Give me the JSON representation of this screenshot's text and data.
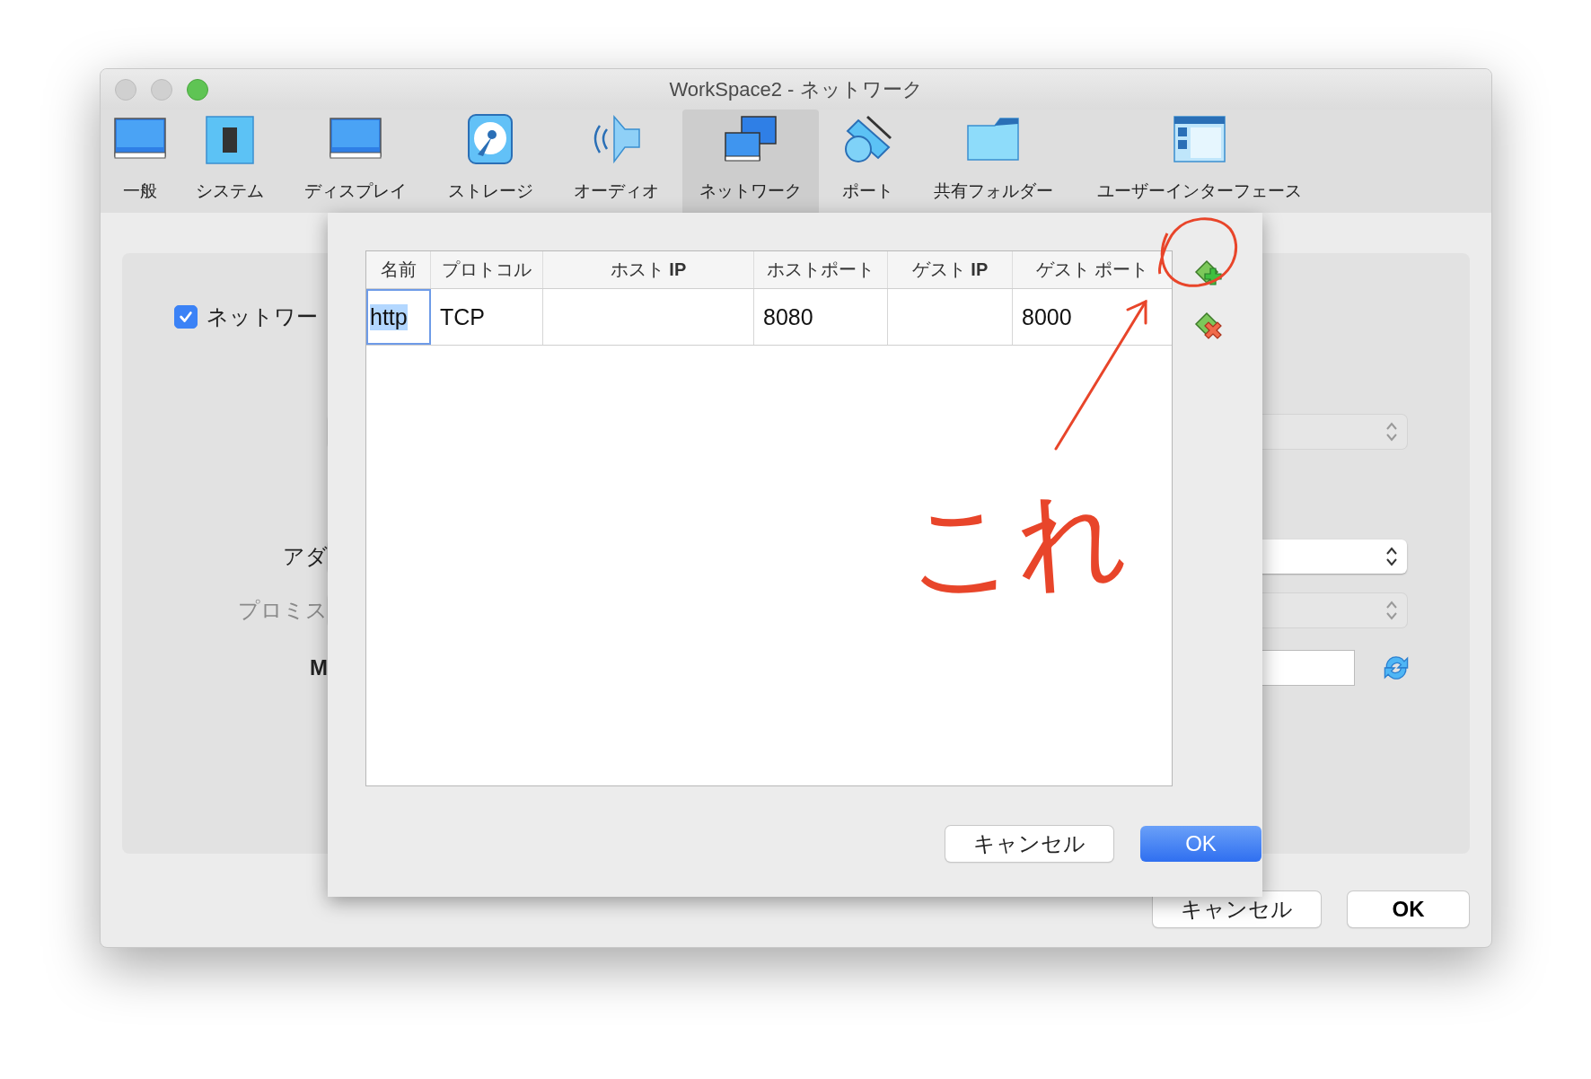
{
  "window": {
    "title": "WorkSpace2 - ネットワーク"
  },
  "tabs": [
    {
      "label": "一般",
      "selected": false
    },
    {
      "label": "システム",
      "selected": false
    },
    {
      "label": "ディスプレイ",
      "selected": false
    },
    {
      "label": "ストレージ",
      "selected": false
    },
    {
      "label": "オーディオ",
      "selected": false
    },
    {
      "label": "ネットワーク",
      "selected": true
    },
    {
      "label": "ポート",
      "selected": false
    },
    {
      "label": "共有フォルダー",
      "selected": false
    },
    {
      "label": "ユーザーインターフェース",
      "selected": false
    }
  ],
  "settings": {
    "enable": {
      "label": "ネットワー",
      "checked": true
    },
    "rows": [
      {
        "kind": "select",
        "disabled": true
      },
      {
        "kind": "select",
        "label": "アダ",
        "disabled": false
      },
      {
        "kind": "select",
        "label": "プロミス",
        "disabled": true
      },
      {
        "kind": "text",
        "label": "M",
        "disabled": false
      }
    ]
  },
  "dialog": {
    "columns": [
      "名前",
      "プロトコル",
      "ホスト **IP**",
      "ホストポート",
      "ゲスト **IP**",
      "ゲスト ポート"
    ],
    "rows": [
      {
        "cells": [
          {
            "text": "http",
            "focused": true
          },
          {
            "text": "TCP",
            "focused": false
          },
          {
            "text": "",
            "focused": false
          },
          {
            "text": "8080",
            "focused": false
          },
          {
            "text": "",
            "focused": false
          },
          {
            "text": "8000",
            "focused": false
          }
        ]
      }
    ],
    "buttons": [
      {
        "label": "キャンセル",
        "kind": "normal"
      },
      {
        "label": "OK",
        "kind": "default"
      }
    ]
  },
  "buttons": [
    {
      "label": "キャンセル",
      "kind": "normal"
    },
    {
      "label": "OK",
      "kind": "default"
    }
  ],
  "annotation": {
    "text": "これ"
  }
}
